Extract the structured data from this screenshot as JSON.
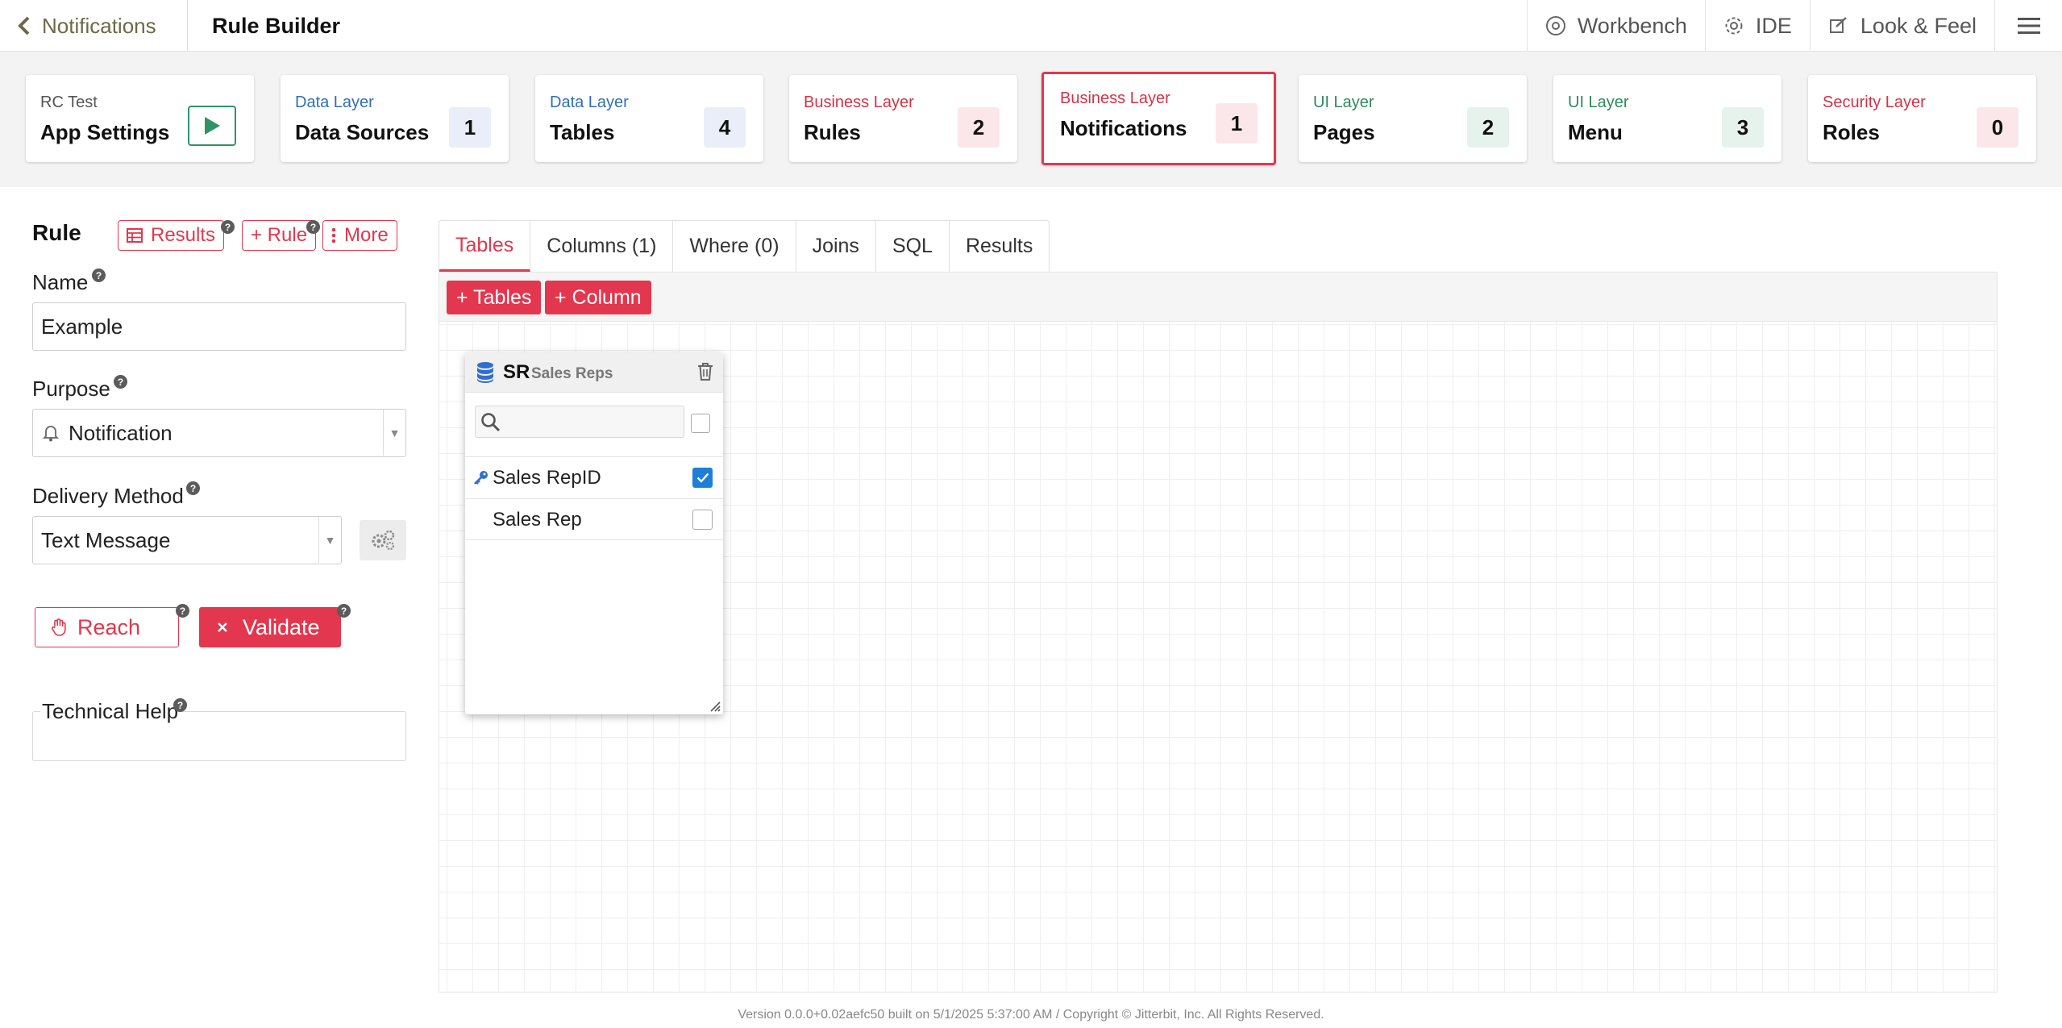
{
  "topbar": {
    "back_label": "Notifications",
    "page_title": "Rule Builder",
    "nav": [
      {
        "label": "Workbench",
        "icon": "workbench-icon"
      },
      {
        "label": "IDE",
        "icon": "gear-icon"
      },
      {
        "label": "Look & Feel",
        "icon": "paint-icon"
      }
    ]
  },
  "cards": [
    {
      "sub": "RC Test",
      "title": "App Settings",
      "sub_color": "#555555"
    },
    {
      "sub": "Data Layer",
      "title": "Data Sources",
      "count": "1",
      "sub_color": "#2f6fb7",
      "badge_bg": "#e9eef8"
    },
    {
      "sub": "Data Layer",
      "title": "Tables",
      "count": "4",
      "sub_color": "#2f6fb7",
      "badge_bg": "#e9eef8"
    },
    {
      "sub": "Business Layer",
      "title": "Rules",
      "count": "2",
      "sub_color": "#d63145",
      "badge_bg": "#fbe7ea"
    },
    {
      "sub": "Business Layer",
      "title": "Notifications",
      "count": "1",
      "sub_color": "#d63145",
      "badge_bg": "#fbe7ea"
    },
    {
      "sub": "UI Layer",
      "title": "Pages",
      "count": "2",
      "sub_color": "#2d8a5f",
      "badge_bg": "#e6f3ec"
    },
    {
      "sub": "UI Layer",
      "title": "Menu",
      "count": "3",
      "sub_color": "#2d8a5f",
      "badge_bg": "#e6f3ec"
    },
    {
      "sub": "Security Layer",
      "title": "Roles",
      "count": "0",
      "sub_color": "#d63145",
      "badge_bg": "#fbe7ea"
    }
  ],
  "rule": {
    "heading": "Rule",
    "results_label": "Results",
    "add_rule_label": "+ Rule",
    "more_label": "More",
    "name_label": "Name",
    "name_value": "Example",
    "purpose_label": "Purpose",
    "purpose_value": "Notification",
    "delivery_label": "Delivery Method",
    "delivery_value": "Text Message",
    "reach_label": "Reach",
    "validate_label": "Validate",
    "tech_help_label": "Technical Help",
    "help_glyph": "?"
  },
  "builder": {
    "tabs": [
      "Tables",
      "Columns (1)",
      "Where (0)",
      "Joins",
      "SQL",
      "Results"
    ],
    "active_tab": "Tables",
    "add_tables_label": "+ Tables",
    "add_column_label": "+ Column",
    "table_widget": {
      "alias": "SR",
      "name": "Sales Reps",
      "search_value": "",
      "columns": [
        {
          "label": "Sales RepID",
          "key": true,
          "checked": true
        },
        {
          "label": "Sales Rep",
          "key": false,
          "checked": false
        }
      ]
    }
  },
  "footer": "Version 0.0.0+0.02aefc50 built on 5/1/2025 5:37:00 AM / Copyright © Jitterbit, Inc. All Rights Reserved.",
  "colors": {
    "accent": "#e2374e",
    "play": "#2e9466",
    "check": "#1e7fd8"
  }
}
